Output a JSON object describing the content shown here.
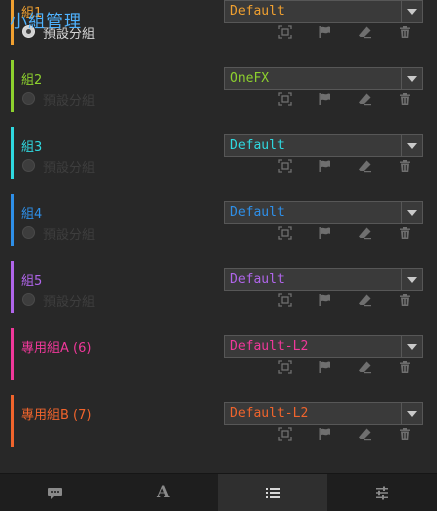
{
  "panel": {
    "title": "小組管理"
  },
  "groups": [
    {
      "name": "組1",
      "color": "#f0a030",
      "preset": "Default",
      "radio_label": "預設分組",
      "radio_selected": true
    },
    {
      "name": "組2",
      "color": "#8dd12e",
      "preset": "OneFX",
      "radio_label": "預設分組",
      "radio_selected": false
    },
    {
      "name": "組3",
      "color": "#2fd9e0",
      "preset": "Default",
      "radio_label": "預設分組",
      "radio_selected": false
    },
    {
      "name": "組4",
      "color": "#2e8fe8",
      "preset": "Default",
      "radio_label": "預設分組",
      "radio_selected": false
    },
    {
      "name": "組5",
      "color": "#b065ea",
      "preset": "Default",
      "radio_label": "預設分組",
      "radio_selected": false
    },
    {
      "name": "專用組A (6)",
      "color": "#f0389a",
      "preset": "Default-L2"
    },
    {
      "name": "專用組B (7)",
      "color": "#f0642c",
      "preset": "Default-L2"
    }
  ],
  "row_icons": [
    "fit-to-view-icon",
    "flag-icon",
    "eraser-icon",
    "trash-icon"
  ],
  "tabs": [
    {
      "icon": "chat-icon",
      "active": false
    },
    {
      "icon": "font-icon",
      "text": "A",
      "active": false
    },
    {
      "icon": "list-icon",
      "active": true
    },
    {
      "icon": "sliders-icon",
      "active": false
    }
  ]
}
